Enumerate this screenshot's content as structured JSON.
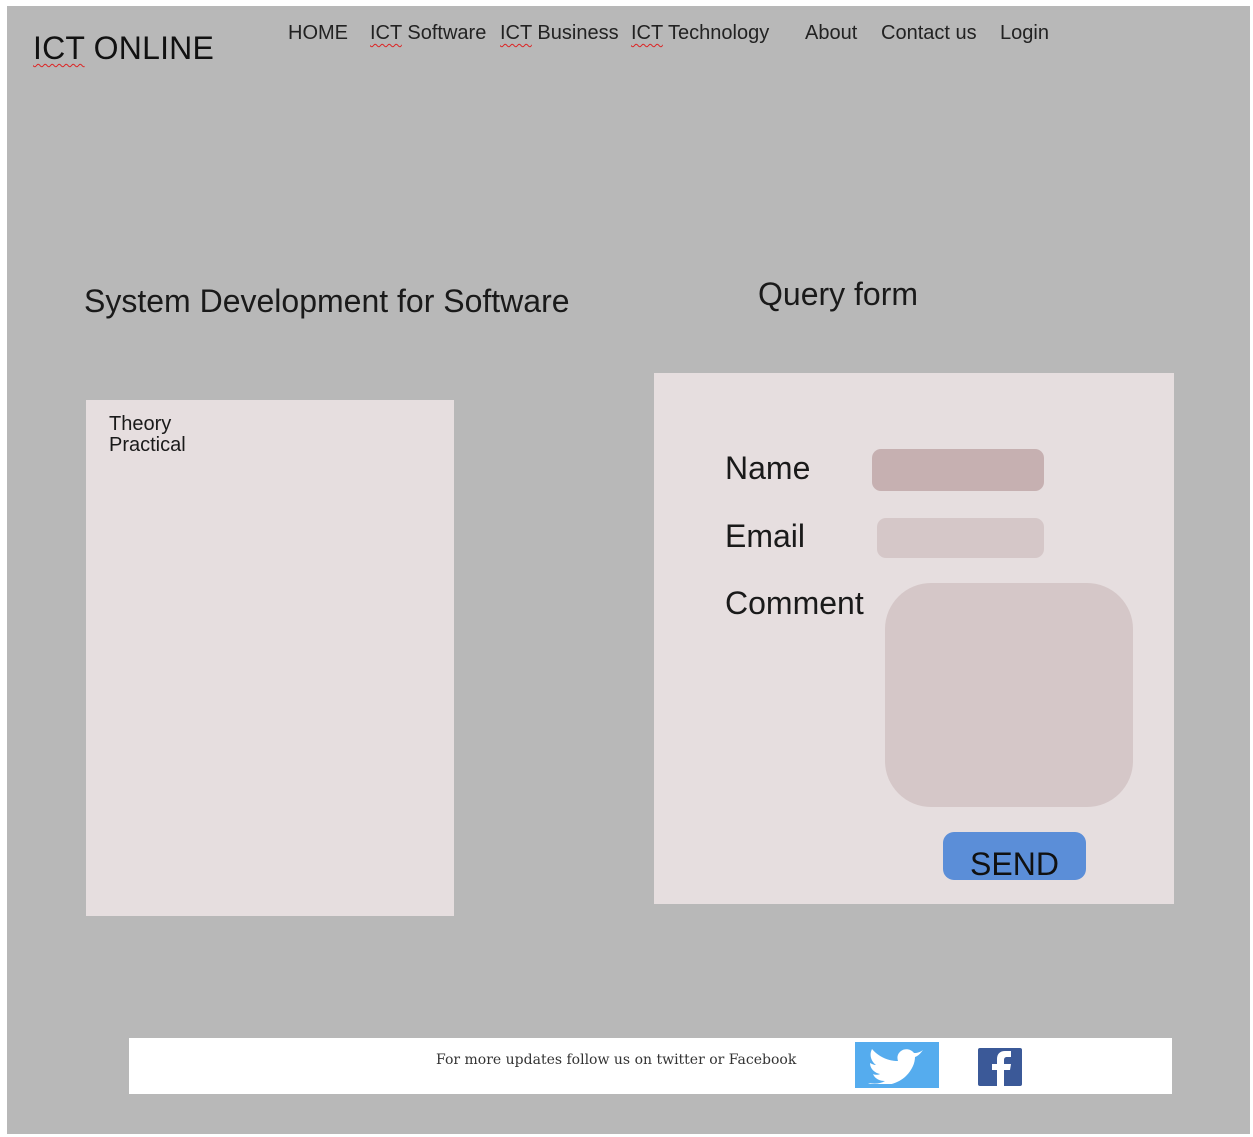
{
  "header": {
    "logo_prefix": "ICT",
    "logo_suffix": " ONLINE"
  },
  "nav": {
    "home": "HOME",
    "ict_software_prefix": "ICT",
    "ict_software_suffix": " Software",
    "ict_business_prefix": "ICT",
    "ict_business_suffix": " Business",
    "ict_technology_prefix": "ICT",
    "ict_technology_suffix": " Technology",
    "about": "About",
    "contact": "Contact us",
    "login": "Login"
  },
  "main": {
    "section_title": "System Development for Software",
    "content_items": [
      "Theory",
      "Practical"
    ]
  },
  "form": {
    "title": "Query form",
    "name_label": "Name",
    "email_label": "Email",
    "comment_label": "Comment",
    "name_value": "",
    "email_value": "",
    "comment_value": "",
    "send_label": "SEND"
  },
  "footer": {
    "text": "For more updates follow us on twitter or Facebook",
    "twitter_icon": "twitter-bird-icon",
    "facebook_icon": "facebook-f-icon"
  },
  "colors": {
    "page_background": "#b8b8b8",
    "panel_background": "#e6dedf",
    "send_button": "#5b8ed8",
    "twitter_blue": "#55acee",
    "facebook_blue": "#3b5998"
  }
}
